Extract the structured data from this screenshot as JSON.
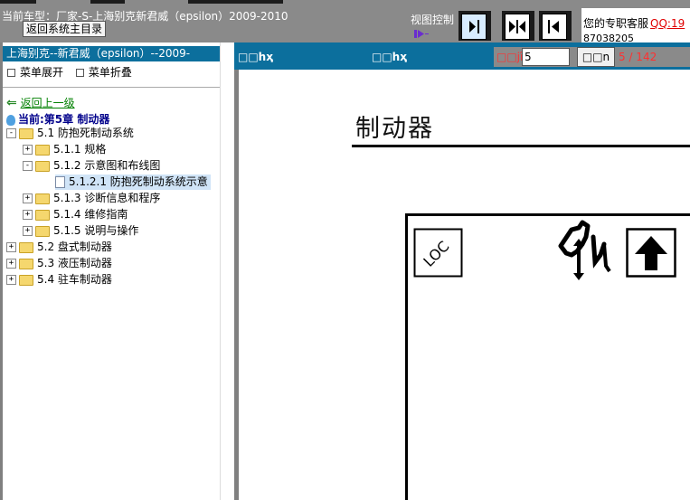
{
  "header": {
    "car_info": "当前车型：厂家-S-上海别克新君威（epsilon）2009-2010",
    "back_main": "返回系统主目录",
    "view_control": "视图控制",
    "service_text": "您的专职客服",
    "service_qq": "QQ:19",
    "service_number": "87038205"
  },
  "sidebar": {
    "title": "上海别克--新君威（epsilon）--2009-",
    "expand": "菜单展开",
    "collapse": "菜单折叠",
    "back_up": "返回上一级",
    "current": "当前:第5章  制动器",
    "tree": [
      {
        "label": "5.1 防抱死制动系统"
      },
      {
        "label": "5.1.1 规格"
      },
      {
        "label": "5.1.2 示意图和布线图"
      },
      {
        "label": "5.1.2.1 防抱死制动系统示意"
      },
      {
        "label": "5.1.3 诊断信息和程序"
      },
      {
        "label": "5.1.4 维修指南"
      },
      {
        "label": "5.1.5 说明与操作"
      },
      {
        "label": "5.2 盘式制动器"
      },
      {
        "label": "5.3 液压制动器"
      },
      {
        "label": "5.4 驻车制动器"
      }
    ]
  },
  "docbar": {
    "btn1": "□□hҳ",
    "btn2": "□□hҳ",
    "page_label": "□□jî",
    "page_value": "5",
    "go": "□□n",
    "page_count": "5 / 142"
  },
  "document": {
    "title": "制动器",
    "loc_text": "LOC"
  },
  "colors": {
    "accent_blue": "#0c6f9d",
    "toolbar_gray": "#8a8a8a",
    "alert_red": "#ff3030"
  }
}
